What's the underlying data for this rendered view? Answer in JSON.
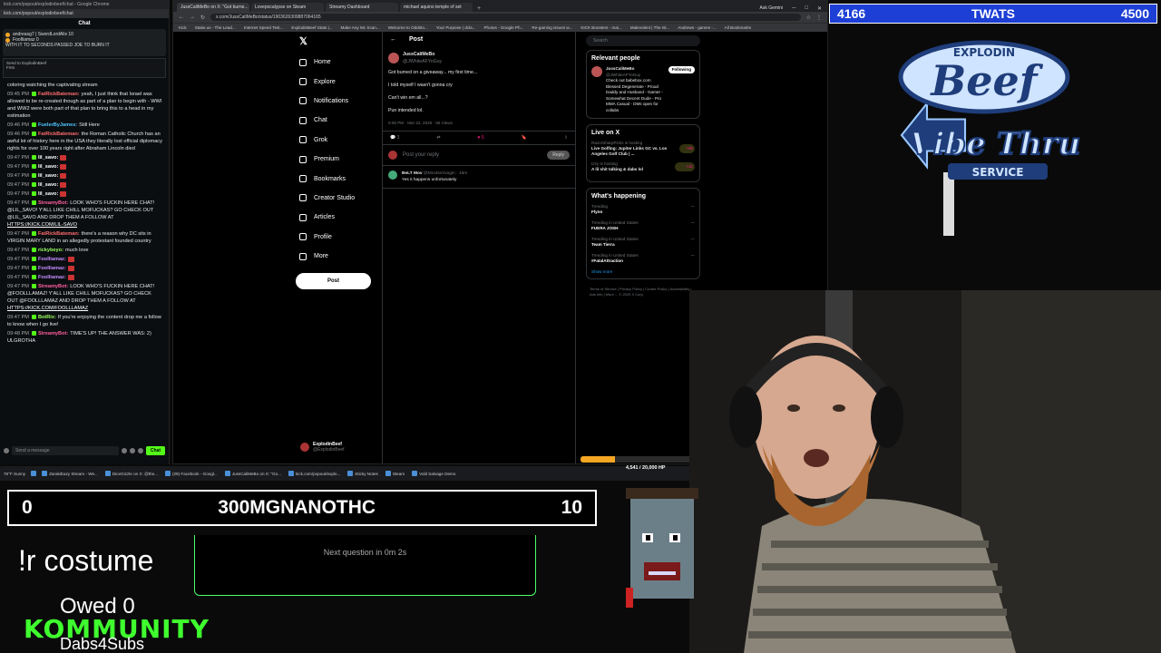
{
  "chat": {
    "window_title": "kick.com/popout/explodinbeef/chat - Google Chrome",
    "url": "kick.com/popout/explodinbeef/chat",
    "title": "Chat",
    "pinned_line1": "andreasg7  |  SwordLordAlix 10",
    "pinned_line2": "FooIliamaz 0",
    "pinned_line3": "WITH IT TO SECONDS PASSED JOE TO BURN IT",
    "send_to": "Send to ExplodinBeef",
    "send_to_sub": "First",
    "messages": [
      {
        "time": "",
        "user": "",
        "text": "coloring watching the captivating stream",
        "color": "u-white"
      },
      {
        "time": "09:45 PM",
        "user": "FatRickBateman:",
        "text": "yeah, I just think that Israel was allowed to be re-created though as part of a plan to begin with - WWI and WW2 were both part of that plan to bring this to a head in my estimation",
        "color": "u-red"
      },
      {
        "time": "09:46 PM",
        "user": "FuelerByJames:",
        "text": "Still Here",
        "color": "u-cyan"
      },
      {
        "time": "09:46 PM",
        "user": "FatRickBateman:",
        "text": "the Roman Catholic Church has an awful lot of history here in the USA they literally lost official diplomacy rights for over 100 years right after Abraham Lincoln died",
        "color": "u-red"
      },
      {
        "time": "09:47 PM",
        "user": "lil_savo:",
        "text": "",
        "color": "u-white"
      },
      {
        "time": "09:47 PM",
        "user": "lil_savo:",
        "text": "",
        "color": "u-white"
      },
      {
        "time": "09:47 PM",
        "user": "lil_savo:",
        "text": "",
        "color": "u-white"
      },
      {
        "time": "09:47 PM",
        "user": "lil_savo:",
        "text": "",
        "color": "u-white"
      },
      {
        "time": "09:47 PM",
        "user": "lil_savo:",
        "text": "",
        "color": "u-white"
      },
      {
        "time": "09:47 PM",
        "user": "StreamyBot:",
        "text": "LOOK WHO'S FUCKIN HERE CHAT! @LIL_SAVO! Y'ALL LIKE CHILL MOFUCKAS? GO CHECK OUT @LIL_SAVO AND DROP THEM A FOLLOW AT",
        "link": "HTTPS://KICK.COM/LIL-SAVO",
        "color": "u-pink"
      },
      {
        "time": "09:47 PM",
        "user": "FatRickBateman:",
        "text": "there's a reason why DC sits in VIRGIN MARY LAND in an allegedly protestant founded country",
        "color": "u-red"
      },
      {
        "time": "09:47 PM",
        "user": "rickybeyo:",
        "text": "much love",
        "color": "u-lime"
      },
      {
        "time": "09:47 PM",
        "user": "FooIliamaz:",
        "text": "",
        "color": "u-purple"
      },
      {
        "time": "09:47 PM",
        "user": "FooIliamaz:",
        "text": "",
        "color": "u-purple"
      },
      {
        "time": "09:47 PM",
        "user": "FooIliamaz:",
        "text": "",
        "color": "u-purple"
      },
      {
        "time": "09:47 PM",
        "user": "StreamyBot:",
        "text": "LOOK WHO'S FUCKIN HERE CHAT! @FOOLLLAMAZ! Y'ALL LIKE CHILL MOFUCKAS? GO CHECK OUT @FOOLLLAMAZ AND DROP THEM A FOLLOW AT",
        "link": "HTTPS://KICK.COM/FOOLLLAMAZ",
        "color": "u-pink"
      },
      {
        "time": "09:47 PM",
        "user": "BotRix:",
        "text": "If you're enjoying the content drop me a follow to know when I go live!",
        "color": "u-lime"
      },
      {
        "time": "09:48 PM",
        "user": "StreamyBot:",
        "text": "TIME'S UP! THE ANSWER WAS: 2) ULGROTHA",
        "color": "u-pink"
      }
    ],
    "input_placeholder": "Send a message",
    "send_label": "Chat"
  },
  "browser": {
    "tabs": [
      "JussCaliMeBo on X: \"Got burne...",
      "Lovepocalypse on Steam",
      "Streamy Dashboard",
      "michael aquino temple of set"
    ],
    "new_tab": "+",
    "ask_gemini": "Ask Gemini",
    "url": "x.com/JussCaliMeBo/status/1903626309887064165",
    "bookmarks": [
      "Kick",
      "Stake.us - The Lead...",
      "Internet Speed Test...",
      "ExplodinBeef Stats |...",
      "Make Any Mc Scan...",
      "Welcome to Oddsto...",
      "Your Purpose | dcla...",
      "Photos - Google Ph...",
      "Re-gaming issues w...",
      "KICK Boosters - mai...",
      "Malevolent | The Isl...",
      "Andrews - games -...",
      "All Bookmarks"
    ]
  },
  "x": {
    "nav": [
      {
        "label": "Home",
        "icon": "home-icon"
      },
      {
        "label": "Explore",
        "icon": "search-icon"
      },
      {
        "label": "Notifications",
        "icon": "bell-icon"
      },
      {
        "label": "Chat",
        "icon": "mail-icon"
      },
      {
        "label": "Grok",
        "icon": "grok-icon"
      },
      {
        "label": "Premium",
        "icon": "x-premium-icon"
      },
      {
        "label": "Bookmarks",
        "icon": "bookmark-icon"
      },
      {
        "label": "Creator Studio",
        "icon": "lightning-icon"
      },
      {
        "label": "Articles",
        "icon": "article-icon"
      },
      {
        "label": "Profile",
        "icon": "person-icon"
      },
      {
        "label": "More",
        "icon": "more-icon"
      }
    ],
    "post_button": "Post",
    "account_name": "ExplodinBeef",
    "account_handle": "@ExplodinBeef",
    "header": "Post",
    "tweet": {
      "author": "JussCaliMeBo",
      "handle": "@JWhiteAFYoGuy",
      "lines": [
        "Got burned on a giveaway... my first time...",
        "I told myself I wasn't gonna cry",
        "Can't win em all...?",
        "Pun intended lol."
      ],
      "meta": "9:05 PM · Mar 22, 2025 · 56 Views",
      "replies": "3",
      "reposts": "",
      "likes": "5"
    },
    "reply_placeholder": "Post your reply",
    "reply_button": "Reply",
    "comment": {
      "author": "BeLT Mov",
      "handle": "@MovDaYungin · 15m",
      "text": "Yes it happens unfortunately"
    },
    "search_placeholder": "Search",
    "relevant": {
      "title": "Relevant people",
      "name": "JussCaliMeBo",
      "handle": "@JWhiteAFYoGuy",
      "follow": "Following",
      "bio": "Check out babebox.com Blessed Degenerate - Proud Daddy and Husband - Gamer - Somewhat Decent Dude - Pro MMA Casual - DMs open for collabs"
    },
    "live": {
      "title": "Live on X",
      "items": [
        {
          "who": "RazorSharpPicks is hosting",
          "text": "Live Golfing: Jupiter Links GC vs. Los Angeles Golf Club | ...",
          "count": "+85"
        },
        {
          "who": "Izzy is hosting",
          "text": "A lil shit talking & dabs lol",
          "count": "+31"
        }
      ]
    },
    "happening": {
      "title": "What's happening",
      "trends": [
        {
          "ctx": "Trending",
          "name": "Flynn"
        },
        {
          "ctx": "Trending in United States",
          "name": "FUERA JOSH"
        },
        {
          "ctx": "Trending in United States",
          "name": "Team Tierra"
        },
        {
          "ctx": "Trending in United States",
          "name": "#FatalAttraction"
        }
      ],
      "show_more": "Show more"
    },
    "footer": "Terms of Service  |  Privacy Policy  |  Cookie Policy  |  Accessibility  |  Ads info  |  More ...  © 2025 X Corp."
  },
  "taskbar": {
    "weather": "76°F Sunny",
    "items": [
      "ZarakiEazy Stream - We...",
      "DiceGizzle on X: @the...",
      "(29) Facebook - Googl...",
      "JussCaliMeBo on X: \"Go...",
      "kick.com/popout/explo...",
      "Sticky Notes",
      "Steam",
      "Vold Salvage Demo"
    ]
  },
  "hp": {
    "text": "4,541 / 20,000 HP",
    "fraction": 0.227
  },
  "overlay": {
    "top_left_score": "4166",
    "top_label": "TWATS",
    "top_right_score": "4500",
    "bottom_left_score": "0",
    "bottom_label": "300MGNANOTHC",
    "bottom_right_score": "10",
    "question_timer": "Next question in 0m 2s",
    "command": "!r costume",
    "owed": "Owed 0",
    "kommunity": "KOMMUNITY",
    "dabs": "Dabs4Subs",
    "logo_top": "EXPLODIN",
    "logo_beef": "Beef",
    "logo_vibe": "Vibe Thru",
    "logo_service": "SERVICE"
  },
  "colors": {
    "kick_green": "#53fc18",
    "twats_blue": "#1d3fd6",
    "like_pink": "#f91880",
    "hp_orange": "#f5a623"
  }
}
